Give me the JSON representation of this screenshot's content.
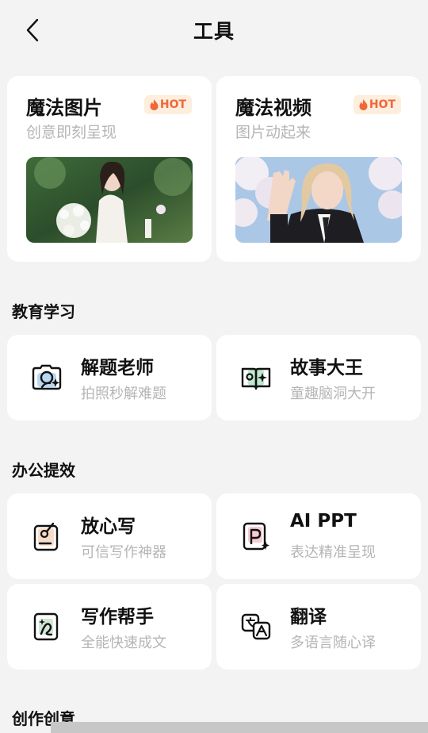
{
  "header": {
    "title": "工具"
  },
  "featured": [
    {
      "title": "魔法图片",
      "subtitle": "创意即刻呈现",
      "badge": "HOT",
      "image": "bride-with-flowers-photo"
    },
    {
      "title": "魔法视频",
      "subtitle": "图片动起来",
      "badge": "HOT",
      "image": "girl-waving-under-cherry-blossoms-photo"
    }
  ],
  "sections": [
    {
      "title": "教育学习",
      "tools": [
        {
          "title": "解题老师",
          "subtitle": "拍照秒解难题",
          "icon": "camera-solve-icon"
        },
        {
          "title": "故事大王",
          "subtitle": "童趣脑洞大开",
          "icon": "story-book-icon"
        }
      ]
    },
    {
      "title": "办公提效",
      "tools": [
        {
          "title": "放心写",
          "subtitle": "可信写作神器",
          "icon": "write-pen-icon"
        },
        {
          "title": "AI PPT",
          "subtitle": "表达精准呈现",
          "icon": "ppt-icon"
        },
        {
          "title": "写作帮手",
          "subtitle": "全能快速成文",
          "icon": "writing-helper-icon"
        },
        {
          "title": "翻译",
          "subtitle": "多语言随心译",
          "icon": "translate-icon"
        }
      ]
    },
    {
      "title": "创作创意"
    }
  ],
  "colors": {
    "background": "#f3f3f3",
    "card": "#ffffff",
    "hot_text": "#f0673a",
    "hot_bg": "#fdeedd",
    "subtitle": "#b5b5b5"
  }
}
